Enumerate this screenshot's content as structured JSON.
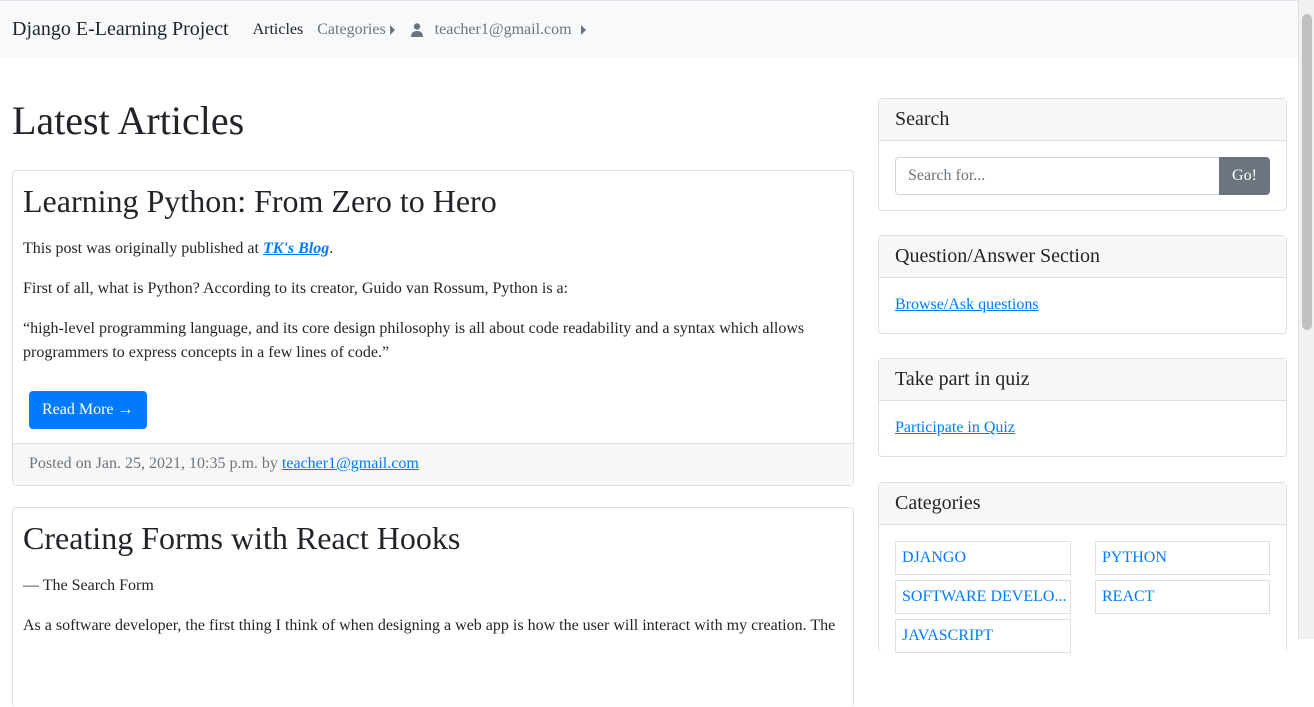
{
  "navbar": {
    "brand": "Django E-Learning Project",
    "articles": "Articles",
    "categories": "Categories",
    "user": "teacher1@gmail.com"
  },
  "main": {
    "title": "Latest Articles",
    "articles": [
      {
        "title": "Learning Python: From Zero to Hero",
        "intro_prefix": "This post was originally published at ",
        "intro_link": "TK's Blog",
        "intro_suffix": ".",
        "p1": "First of all, what is Python? According to its creator, Guido van Rossum, Python is a:",
        "p2": "“high-level programming language, and its core design philosophy is all about code readability and a syntax which allows programmers to express concepts in a few lines of code.”",
        "read_more": "Read More →",
        "posted_prefix": "Posted on Jan. 25, 2021, 10:35 p.m. by ",
        "author": "teacher1@gmail.com"
      },
      {
        "title": "Creating Forms with React Hooks",
        "p1": "— The Search Form",
        "p2": "As a software developer, the first thing I think of when designing a web app is how the user will interact with my creation. The"
      }
    ]
  },
  "sidebar": {
    "search": {
      "title": "Search",
      "placeholder": "Search for...",
      "button": "Go!"
    },
    "qa": {
      "title": "Question/Answer Section",
      "link": "Browse/Ask questions"
    },
    "quiz": {
      "title": "Take part in quiz",
      "link": "Participate in Quiz"
    },
    "categories": {
      "title": "Categories",
      "items": [
        "DJANGO",
        "PYTHON",
        "SOFTWARE DEVELO...",
        "REACT",
        "JAVASCRIPT"
      ]
    }
  },
  "colors": {
    "primary": "#007bff",
    "secondary": "#6c757d",
    "navbar_bg": "#f8f9fa"
  }
}
